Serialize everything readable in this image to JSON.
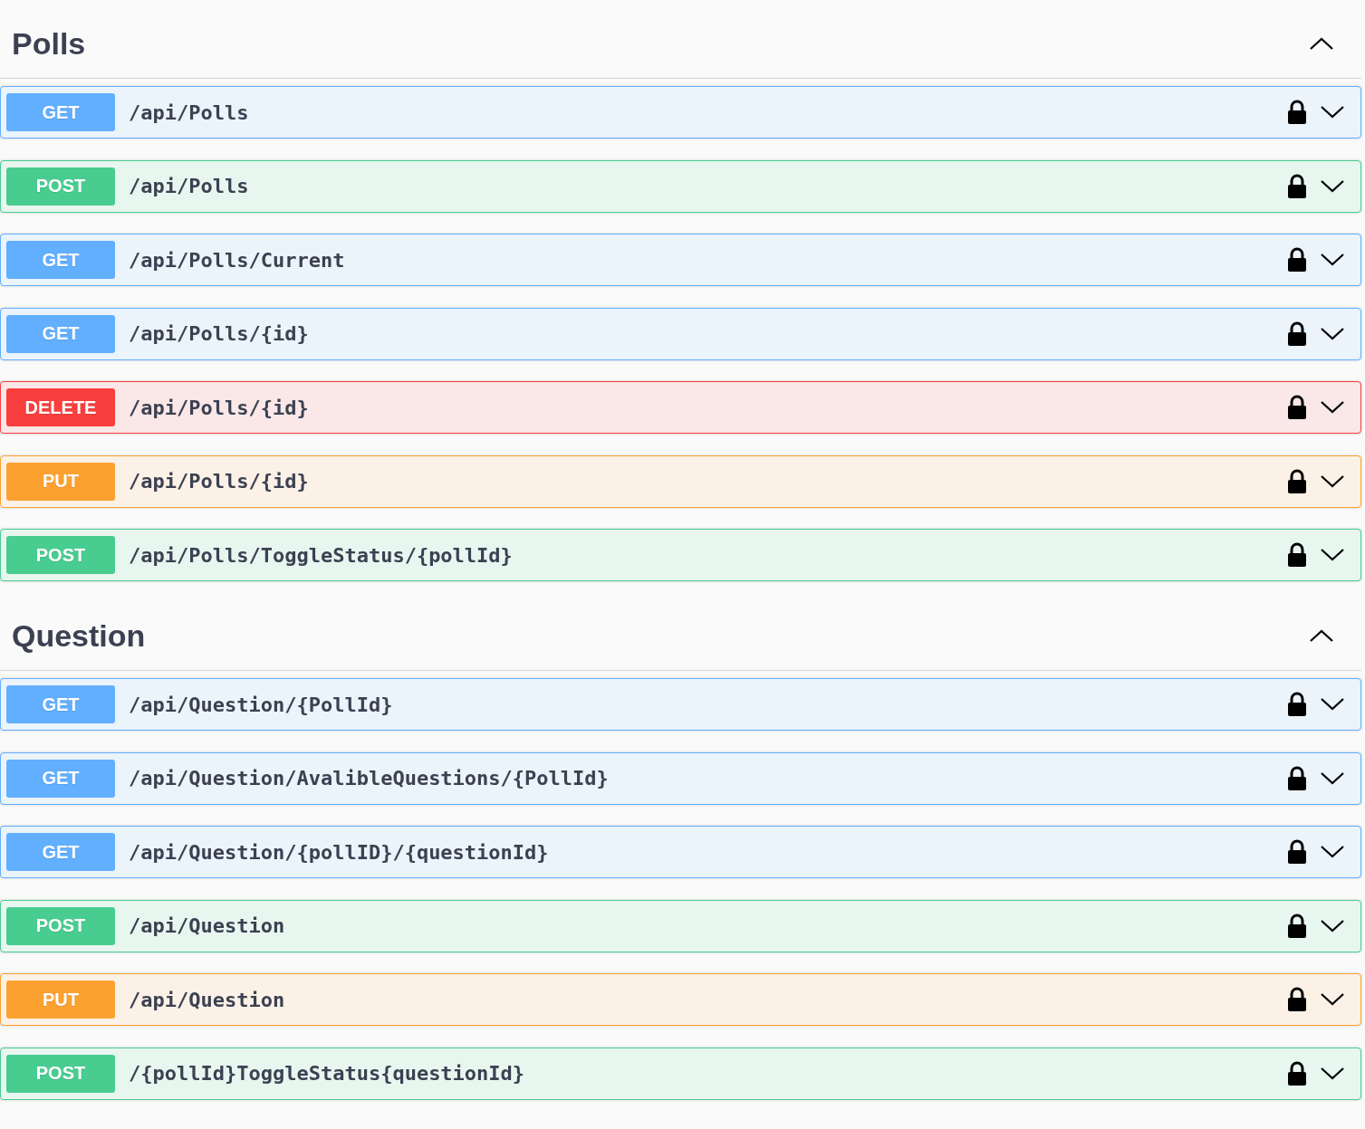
{
  "sections": [
    {
      "title": "Polls",
      "expanded": true,
      "operations": [
        {
          "method": "GET",
          "path": "/api/Polls",
          "expanded": false
        },
        {
          "method": "POST",
          "path": "/api/Polls",
          "expanded": false
        },
        {
          "method": "GET",
          "path": "/api/Polls/Current",
          "expanded": false
        },
        {
          "method": "GET",
          "path": "/api/Polls/{id}",
          "expanded": false
        },
        {
          "method": "DELETE",
          "path": "/api/Polls/{id}",
          "expanded": false
        },
        {
          "method": "PUT",
          "path": "/api/Polls/{id}",
          "expanded": false
        },
        {
          "method": "POST",
          "path": "/api/Polls/ToggleStatus/{pollId}",
          "expanded": false
        }
      ]
    },
    {
      "title": "Question",
      "expanded": true,
      "operations": [
        {
          "method": "GET",
          "path": "/api/Question/{PollId}",
          "expanded": false
        },
        {
          "method": "GET",
          "path": "/api/Question/AvalibleQuestions/{PollId}",
          "expanded": false
        },
        {
          "method": "GET",
          "path": "/api/Question/{pollID}/{questionId}",
          "expanded": false
        },
        {
          "method": "POST",
          "path": "/api/Question",
          "expanded": false
        },
        {
          "method": "PUT",
          "path": "/api/Question",
          "expanded": false
        },
        {
          "method": "POST",
          "path": "/{pollId}ToggleStatus{questionId}",
          "expanded": false
        }
      ]
    }
  ]
}
